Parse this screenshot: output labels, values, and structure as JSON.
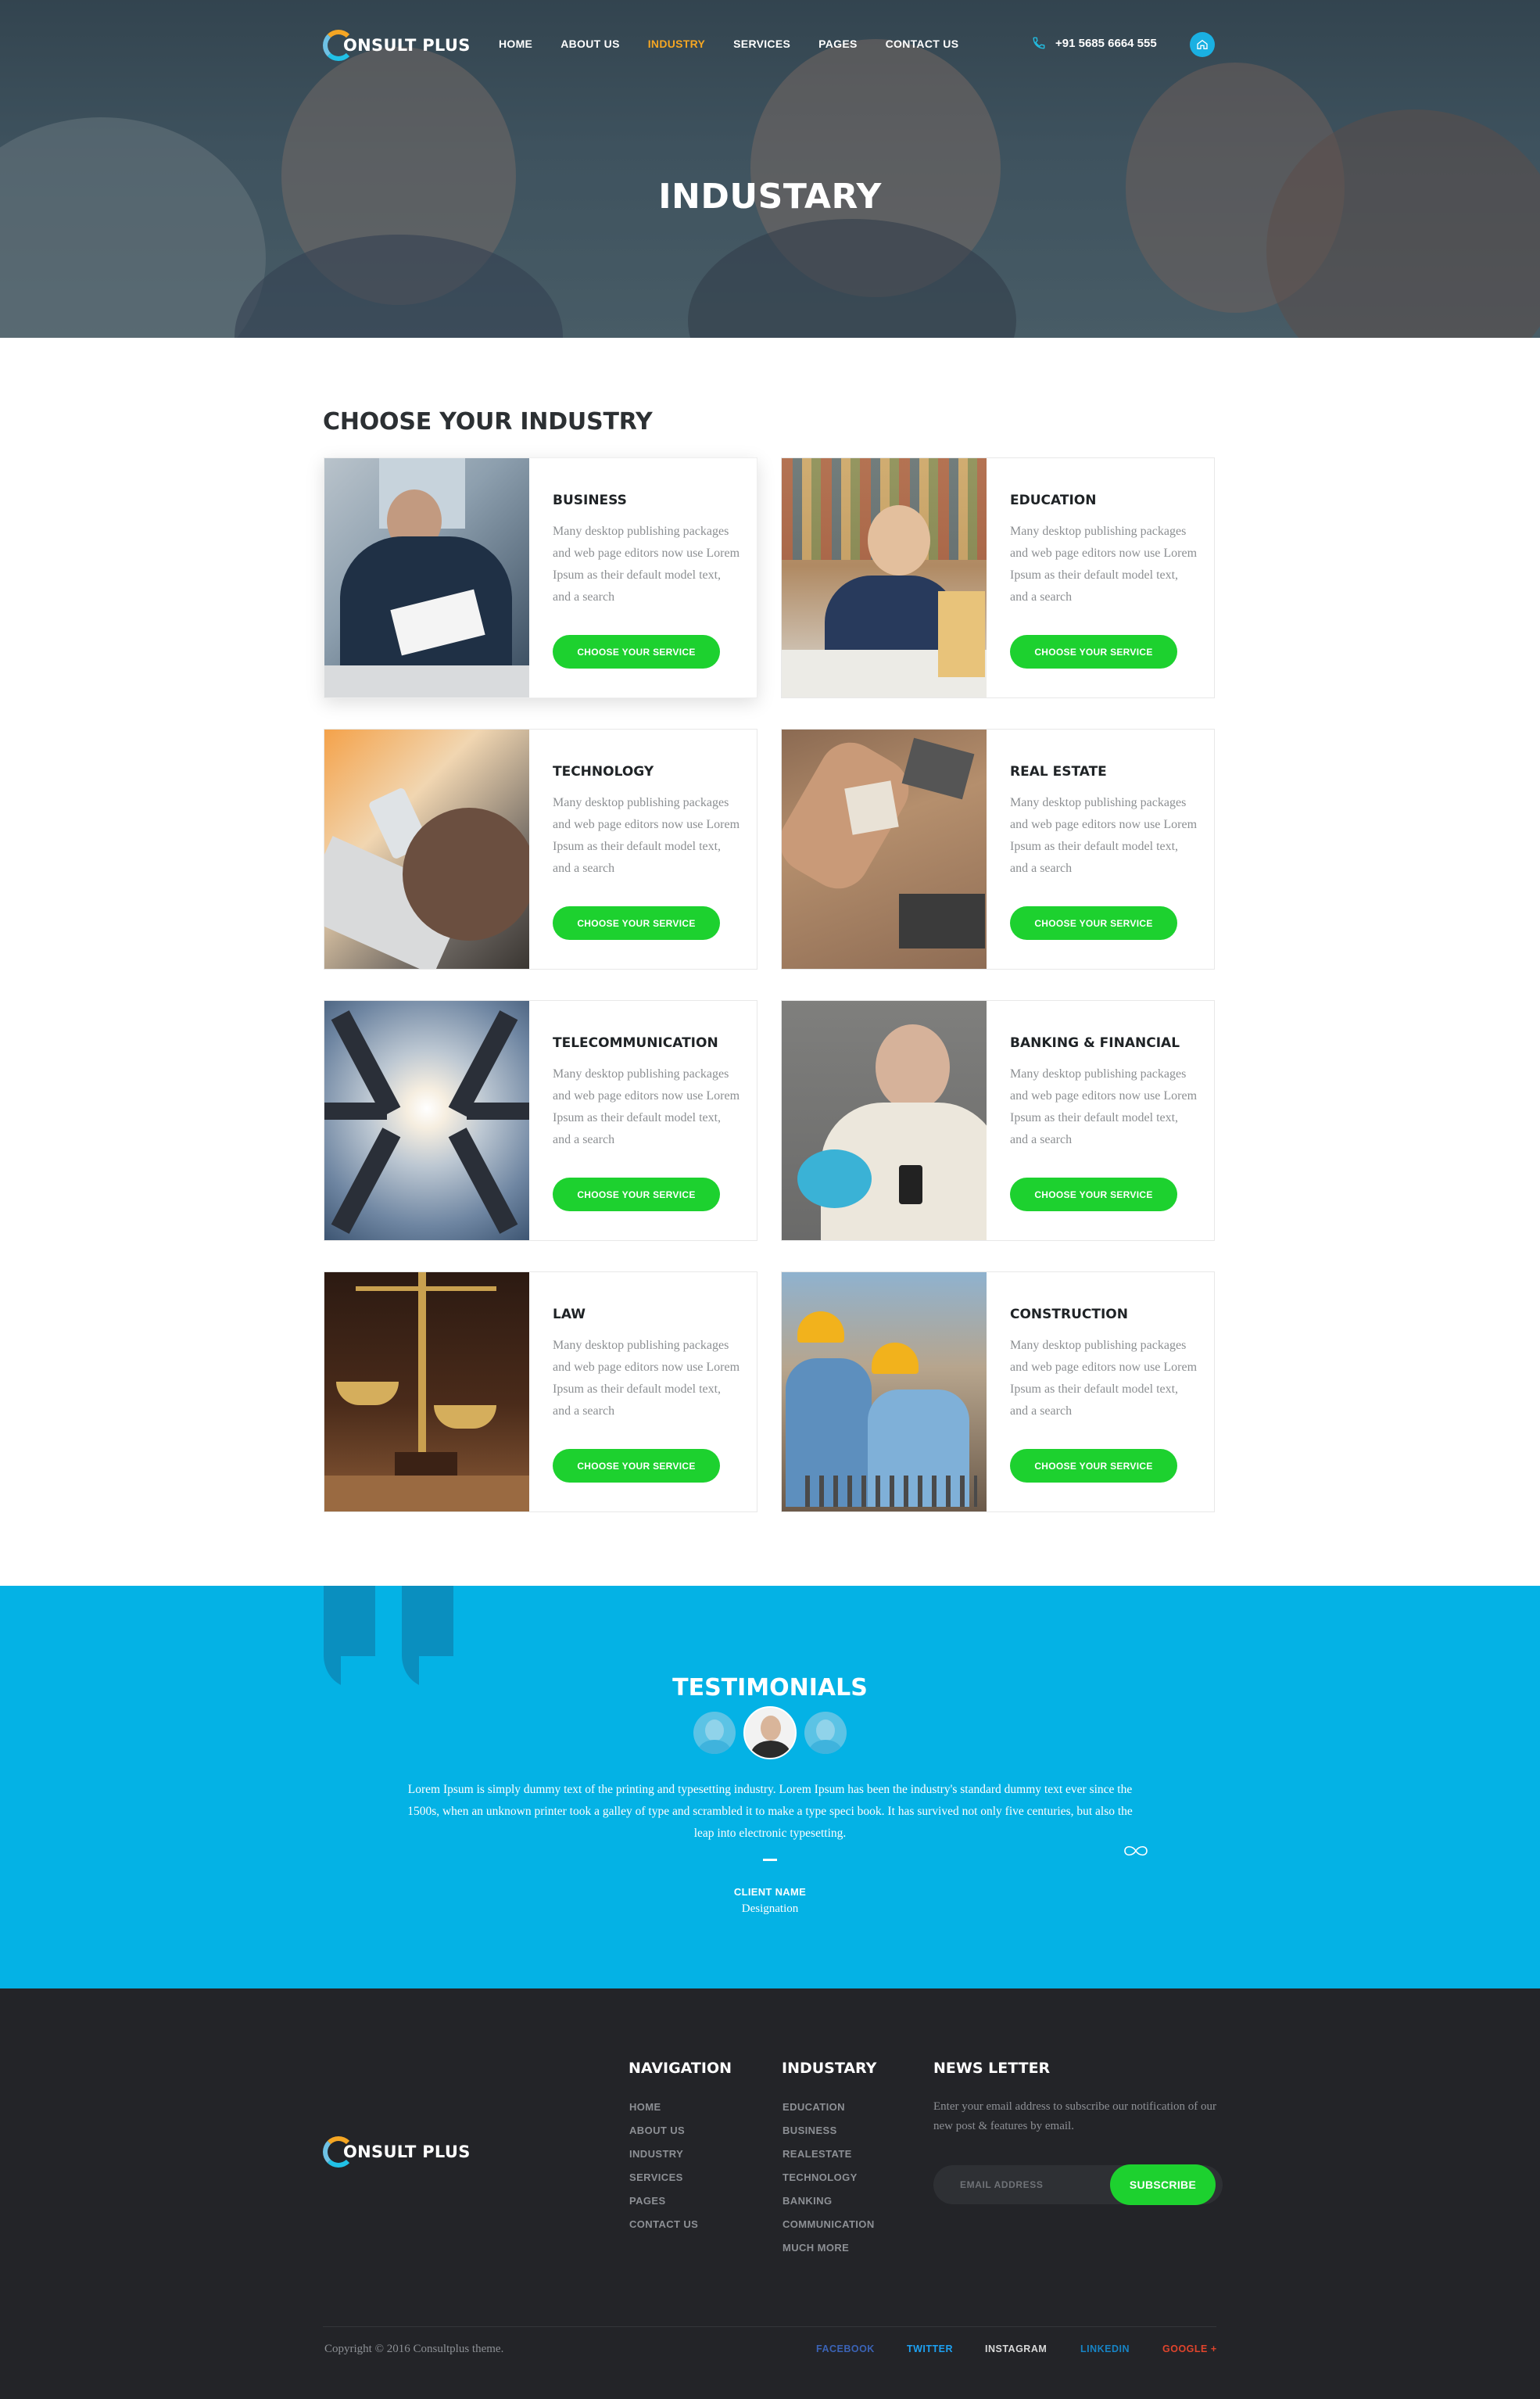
{
  "brand": {
    "name": "ONSULT PLUS"
  },
  "nav": {
    "items": [
      {
        "label": "HOME",
        "active": false
      },
      {
        "label": "ABOUT US",
        "active": false
      },
      {
        "label": "INDUSTRY",
        "active": true
      },
      {
        "label": "SERVICES",
        "active": false
      },
      {
        "label": "PAGES",
        "active": false
      },
      {
        "label": "CONTACT US",
        "active": false
      }
    ],
    "phone": "+91 5685 6664 555",
    "phone_icon": "phone-icon",
    "home_icon": "home-icon"
  },
  "hero": {
    "title": "INDUSTARY"
  },
  "industries": {
    "title": "CHOOSE YOUR INDUSTRY",
    "cards": [
      {
        "title": "BUSINESS",
        "desc": "Many desktop publishing packages and web page editors now use Lorem Ipsum as their default model text, and a search",
        "button": "CHOOSE YOUR SERVICE",
        "image": "businessman-photo"
      },
      {
        "title": "EDUCATION",
        "desc": "Many desktop publishing packages and web page editors now use Lorem Ipsum as their default model text, and a search",
        "button": "CHOOSE YOUR SERVICE",
        "image": "student-photo"
      },
      {
        "title": "TECHNOLOGY",
        "desc": "Many desktop publishing packages and web page editors now use Lorem Ipsum as their default model text, and a search",
        "button": "CHOOSE YOUR SERVICE",
        "image": "phone-laptop-photo"
      },
      {
        "title": "REAL ESTATE",
        "desc": "Many desktop publishing packages and web page editors now use Lorem Ipsum as their default model text, and a search",
        "button": "CHOOSE YOUR SERVICE",
        "image": "house-key-photo"
      },
      {
        "title": "TELECOMMUNICATION",
        "desc": "Many desktop publishing packages and web page editors now use Lorem Ipsum as their default model text, and a search",
        "button": "CHOOSE YOUR SERVICE",
        "image": "telecom-towers-photo"
      },
      {
        "title": "BANKING & FINANCIAL",
        "desc": "Many desktop publishing packages and web page editors now use Lorem Ipsum as their default model text, and a search",
        "button": "CHOOSE YOUR SERVICE",
        "image": "piggy-bank-photo"
      },
      {
        "title": "LAW",
        "desc": "Many desktop publishing packages and web page editors now use Lorem Ipsum as their default model text, and a search",
        "button": "CHOOSE YOUR SERVICE",
        "image": "scales-of-justice-photo"
      },
      {
        "title": "CONSTRUCTION",
        "desc": "Many desktop publishing packages and web page editors now use Lorem Ipsum as their default model text, and a search",
        "button": "CHOOSE YOUR SERVICE",
        "image": "construction-workers-photo"
      }
    ]
  },
  "testimonials": {
    "title": "TESTIMONIALS",
    "text": "Lorem Ipsum is simply dummy text of the printing and typesetting industry. Lorem Ipsum has been the industry's standard dummy text ever since the 1500s, when an unknown printer took a galley of type and scrambled it to make a type speci book. It has survived not only five centuries, but also the leap into electronic typesetting.",
    "client_name": "CLIENT NAME",
    "designation": "Designation"
  },
  "footer": {
    "navigation": {
      "title": "NAVIGATION",
      "items": [
        "HOME",
        "ABOUT US",
        "INDUSTRY",
        "SERVICES",
        "PAGES",
        "CONTACT US"
      ]
    },
    "industry": {
      "title": "INDUSTARY",
      "items": [
        "EDUCATION",
        "BUSINESS",
        "REALESTATE",
        "TECHNOLOGY",
        "BANKING",
        "COMMUNICATION",
        "MUCH MORE"
      ]
    },
    "newsletter": {
      "title": "NEWS LETTER",
      "text": "Enter your email address to subscribe our notification of our new post & features by email.",
      "placeholder": "EMAIL ADDRESS",
      "button": "SUBSCRIBE"
    },
    "copyright": "Copyright © 2016 Consultplus theme.",
    "social": [
      {
        "label": "FACEBOOK",
        "color": "#3b63b6"
      },
      {
        "label": "TWITTER",
        "color": "#1da1f2"
      },
      {
        "label": "INSTAGRAM",
        "color": "#d9d9d9"
      },
      {
        "label": "LINKEDIN",
        "color": "#1783c4"
      },
      {
        "label": "GOOGLE +",
        "color": "#e0442c"
      }
    ]
  },
  "colors": {
    "accent_orange": "#f5a623",
    "button_green": "#1dd12f",
    "testimonial_blue": "#04b2e5",
    "footer_dark": "#232428"
  }
}
